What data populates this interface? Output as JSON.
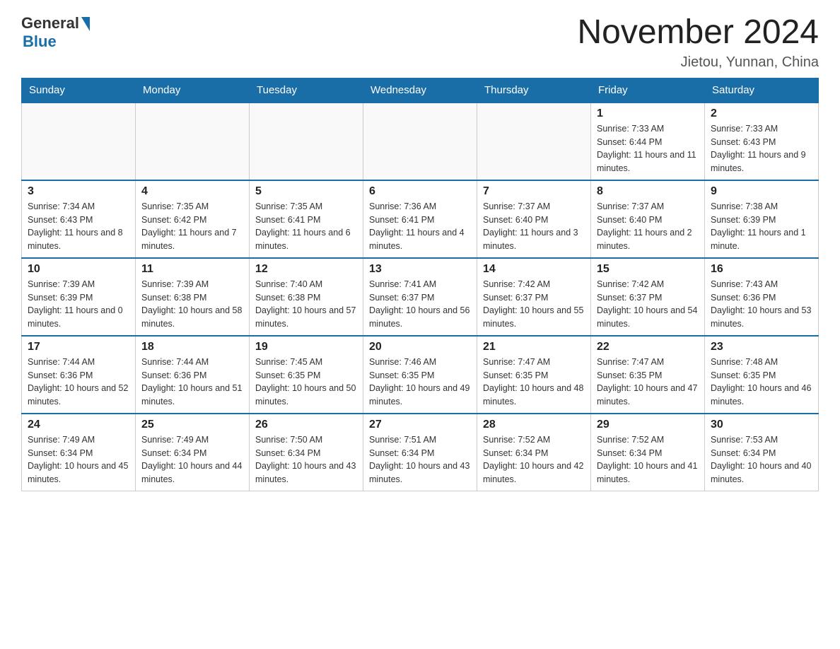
{
  "header": {
    "logo_general": "General",
    "logo_blue": "Blue",
    "month_title": "November 2024",
    "subtitle": "Jietou, Yunnan, China"
  },
  "days_of_week": [
    "Sunday",
    "Monday",
    "Tuesday",
    "Wednesday",
    "Thursday",
    "Friday",
    "Saturday"
  ],
  "weeks": [
    [
      {
        "day": "",
        "info": ""
      },
      {
        "day": "",
        "info": ""
      },
      {
        "day": "",
        "info": ""
      },
      {
        "day": "",
        "info": ""
      },
      {
        "day": "",
        "info": ""
      },
      {
        "day": "1",
        "info": "Sunrise: 7:33 AM\nSunset: 6:44 PM\nDaylight: 11 hours and 11 minutes."
      },
      {
        "day": "2",
        "info": "Sunrise: 7:33 AM\nSunset: 6:43 PM\nDaylight: 11 hours and 9 minutes."
      }
    ],
    [
      {
        "day": "3",
        "info": "Sunrise: 7:34 AM\nSunset: 6:43 PM\nDaylight: 11 hours and 8 minutes."
      },
      {
        "day": "4",
        "info": "Sunrise: 7:35 AM\nSunset: 6:42 PM\nDaylight: 11 hours and 7 minutes."
      },
      {
        "day": "5",
        "info": "Sunrise: 7:35 AM\nSunset: 6:41 PM\nDaylight: 11 hours and 6 minutes."
      },
      {
        "day": "6",
        "info": "Sunrise: 7:36 AM\nSunset: 6:41 PM\nDaylight: 11 hours and 4 minutes."
      },
      {
        "day": "7",
        "info": "Sunrise: 7:37 AM\nSunset: 6:40 PM\nDaylight: 11 hours and 3 minutes."
      },
      {
        "day": "8",
        "info": "Sunrise: 7:37 AM\nSunset: 6:40 PM\nDaylight: 11 hours and 2 minutes."
      },
      {
        "day": "9",
        "info": "Sunrise: 7:38 AM\nSunset: 6:39 PM\nDaylight: 11 hours and 1 minute."
      }
    ],
    [
      {
        "day": "10",
        "info": "Sunrise: 7:39 AM\nSunset: 6:39 PM\nDaylight: 11 hours and 0 minutes."
      },
      {
        "day": "11",
        "info": "Sunrise: 7:39 AM\nSunset: 6:38 PM\nDaylight: 10 hours and 58 minutes."
      },
      {
        "day": "12",
        "info": "Sunrise: 7:40 AM\nSunset: 6:38 PM\nDaylight: 10 hours and 57 minutes."
      },
      {
        "day": "13",
        "info": "Sunrise: 7:41 AM\nSunset: 6:37 PM\nDaylight: 10 hours and 56 minutes."
      },
      {
        "day": "14",
        "info": "Sunrise: 7:42 AM\nSunset: 6:37 PM\nDaylight: 10 hours and 55 minutes."
      },
      {
        "day": "15",
        "info": "Sunrise: 7:42 AM\nSunset: 6:37 PM\nDaylight: 10 hours and 54 minutes."
      },
      {
        "day": "16",
        "info": "Sunrise: 7:43 AM\nSunset: 6:36 PM\nDaylight: 10 hours and 53 minutes."
      }
    ],
    [
      {
        "day": "17",
        "info": "Sunrise: 7:44 AM\nSunset: 6:36 PM\nDaylight: 10 hours and 52 minutes."
      },
      {
        "day": "18",
        "info": "Sunrise: 7:44 AM\nSunset: 6:36 PM\nDaylight: 10 hours and 51 minutes."
      },
      {
        "day": "19",
        "info": "Sunrise: 7:45 AM\nSunset: 6:35 PM\nDaylight: 10 hours and 50 minutes."
      },
      {
        "day": "20",
        "info": "Sunrise: 7:46 AM\nSunset: 6:35 PM\nDaylight: 10 hours and 49 minutes."
      },
      {
        "day": "21",
        "info": "Sunrise: 7:47 AM\nSunset: 6:35 PM\nDaylight: 10 hours and 48 minutes."
      },
      {
        "day": "22",
        "info": "Sunrise: 7:47 AM\nSunset: 6:35 PM\nDaylight: 10 hours and 47 minutes."
      },
      {
        "day": "23",
        "info": "Sunrise: 7:48 AM\nSunset: 6:35 PM\nDaylight: 10 hours and 46 minutes."
      }
    ],
    [
      {
        "day": "24",
        "info": "Sunrise: 7:49 AM\nSunset: 6:34 PM\nDaylight: 10 hours and 45 minutes."
      },
      {
        "day": "25",
        "info": "Sunrise: 7:49 AM\nSunset: 6:34 PM\nDaylight: 10 hours and 44 minutes."
      },
      {
        "day": "26",
        "info": "Sunrise: 7:50 AM\nSunset: 6:34 PM\nDaylight: 10 hours and 43 minutes."
      },
      {
        "day": "27",
        "info": "Sunrise: 7:51 AM\nSunset: 6:34 PM\nDaylight: 10 hours and 43 minutes."
      },
      {
        "day": "28",
        "info": "Sunrise: 7:52 AM\nSunset: 6:34 PM\nDaylight: 10 hours and 42 minutes."
      },
      {
        "day": "29",
        "info": "Sunrise: 7:52 AM\nSunset: 6:34 PM\nDaylight: 10 hours and 41 minutes."
      },
      {
        "day": "30",
        "info": "Sunrise: 7:53 AM\nSunset: 6:34 PM\nDaylight: 10 hours and 40 minutes."
      }
    ]
  ]
}
